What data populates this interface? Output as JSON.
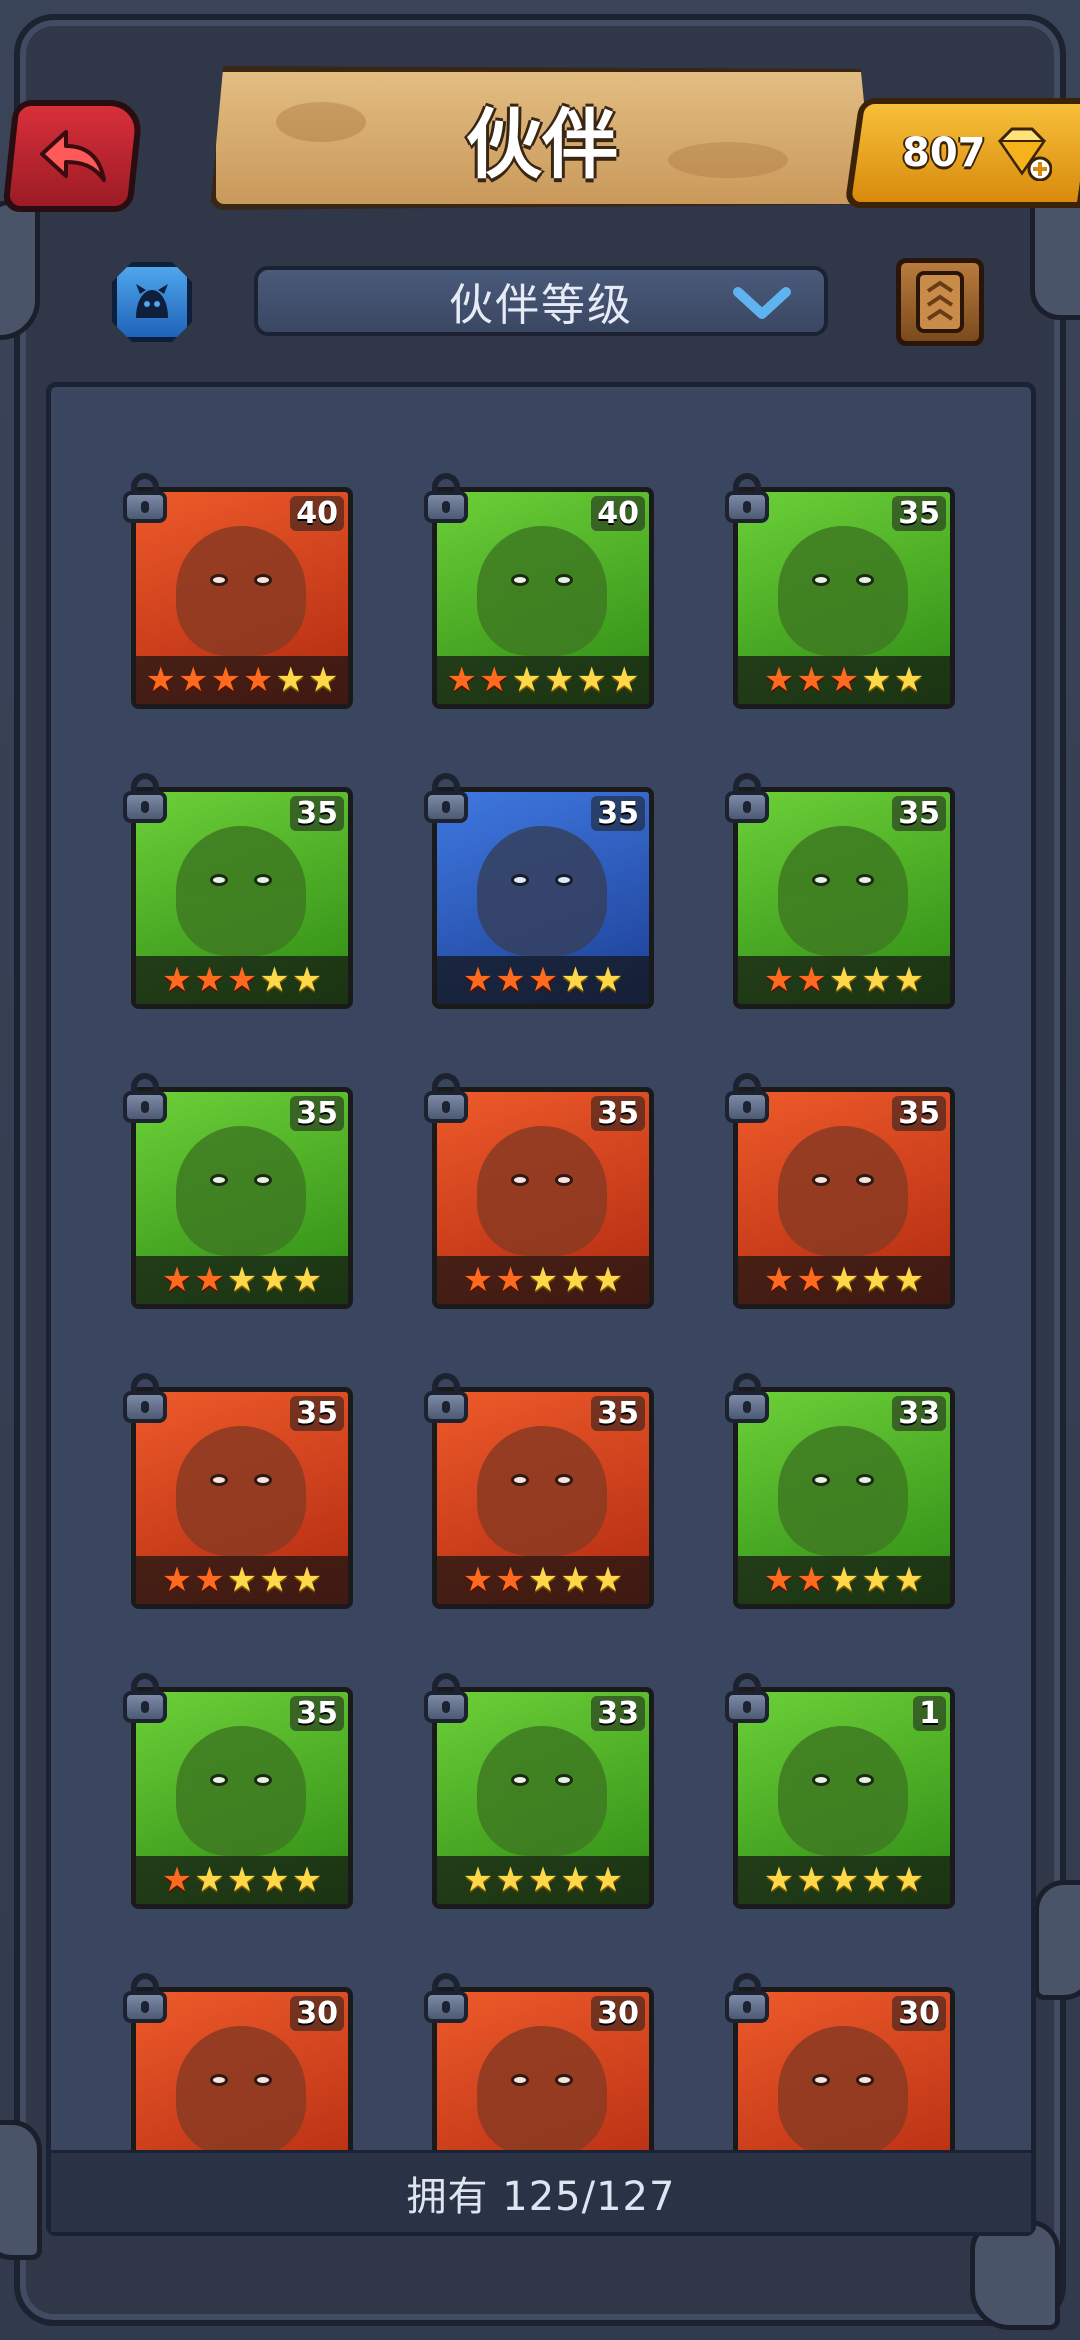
{
  "header": {
    "title": "伙伴",
    "gems": "807"
  },
  "filter": {
    "sort_label": "伙伴等级"
  },
  "colors": {
    "card_red": "#d83a18",
    "card_green": "#3fae1c",
    "card_blue": "#2a5ec8",
    "star_red": "#ff6a1f",
    "star_gold": "#ffd84a"
  },
  "companions": [
    {
      "level": "40",
      "bg": "red",
      "stars": [
        "red",
        "red",
        "red",
        "red",
        "gold",
        "gold"
      ]
    },
    {
      "level": "40",
      "bg": "green",
      "stars": [
        "red",
        "red",
        "gold",
        "gold",
        "gold",
        "gold"
      ]
    },
    {
      "level": "35",
      "bg": "green",
      "stars": [
        "red",
        "red",
        "red",
        "gold",
        "gold"
      ]
    },
    {
      "level": "35",
      "bg": "green",
      "stars": [
        "red",
        "red",
        "red",
        "gold",
        "gold"
      ]
    },
    {
      "level": "35",
      "bg": "blue",
      "stars": [
        "red",
        "red",
        "red",
        "gold",
        "gold"
      ]
    },
    {
      "level": "35",
      "bg": "green",
      "stars": [
        "red",
        "red",
        "gold",
        "gold",
        "gold"
      ]
    },
    {
      "level": "35",
      "bg": "green",
      "stars": [
        "red",
        "red",
        "gold",
        "gold",
        "gold"
      ]
    },
    {
      "level": "35",
      "bg": "red",
      "stars": [
        "red",
        "red",
        "gold",
        "gold",
        "gold"
      ]
    },
    {
      "level": "35",
      "bg": "red",
      "stars": [
        "red",
        "red",
        "gold",
        "gold",
        "gold"
      ]
    },
    {
      "level": "35",
      "bg": "red",
      "stars": [
        "red",
        "red",
        "gold",
        "gold",
        "gold"
      ]
    },
    {
      "level": "35",
      "bg": "red",
      "stars": [
        "red",
        "red",
        "gold",
        "gold",
        "gold"
      ]
    },
    {
      "level": "33",
      "bg": "green",
      "stars": [
        "red",
        "red",
        "gold",
        "gold",
        "gold"
      ]
    },
    {
      "level": "35",
      "bg": "green",
      "stars": [
        "red",
        "gold",
        "gold",
        "gold",
        "gold"
      ]
    },
    {
      "level": "33",
      "bg": "green",
      "stars": [
        "gold",
        "gold",
        "gold",
        "gold",
        "gold"
      ]
    },
    {
      "level": "1",
      "bg": "green",
      "stars": [
        "gold",
        "gold",
        "gold",
        "gold",
        "gold"
      ]
    },
    {
      "level": "30",
      "bg": "red",
      "stars": []
    },
    {
      "level": "30",
      "bg": "red",
      "stars": []
    },
    {
      "level": "30",
      "bg": "red",
      "stars": []
    }
  ],
  "footer": {
    "owned_text": "拥有 125/127"
  }
}
